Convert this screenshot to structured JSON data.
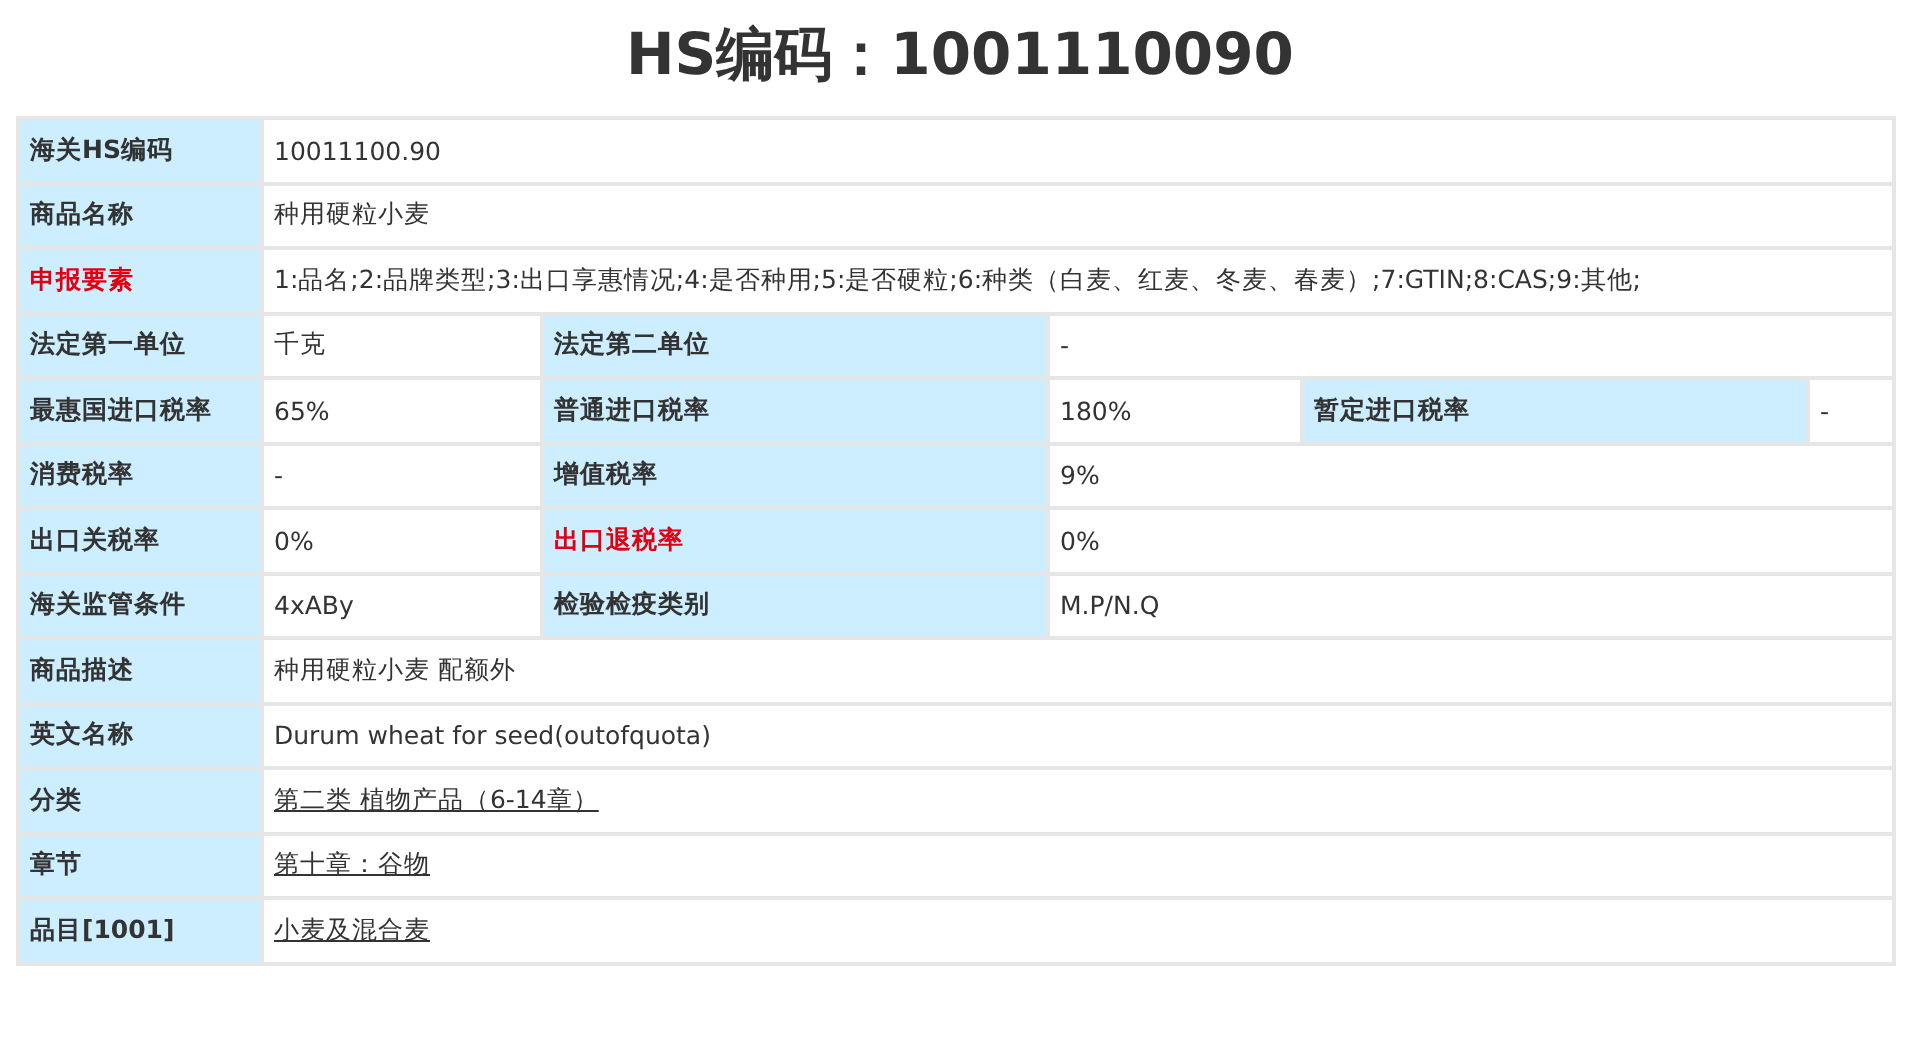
{
  "title": "HS编码：1001110090",
  "rows": [
    [
      {
        "kind": "label",
        "text": "海关HS编码"
      },
      {
        "kind": "value",
        "text": "10011100.90"
      }
    ],
    [
      {
        "kind": "label",
        "text": "商品名称"
      },
      {
        "kind": "value",
        "text": "种用硬粒小麦"
      }
    ],
    [
      {
        "kind": "alert_label",
        "text": "申报要素"
      },
      {
        "kind": "value",
        "text": "1:品名;2:品牌类型;3:出口享惠情况;4:是否种用;5:是否硬粒;6:种类（白麦、红麦、冬麦、春麦）;7:GTIN;8:CAS;9:其他;"
      }
    ],
    [
      {
        "kind": "label",
        "text": "法定第一单位"
      },
      {
        "kind": "value",
        "text": "千克"
      },
      {
        "kind": "label",
        "text": "法定第二单位"
      },
      {
        "kind": "value",
        "text": "-"
      }
    ],
    [
      {
        "kind": "label",
        "text": "最惠国进口税率"
      },
      {
        "kind": "value",
        "text": "65%"
      },
      {
        "kind": "label",
        "text": "普通进口税率"
      },
      {
        "kind": "value",
        "text": "180%"
      },
      {
        "kind": "label",
        "text": "暂定进口税率"
      },
      {
        "kind": "value",
        "text": "-"
      }
    ],
    [
      {
        "kind": "label",
        "text": "消费税率"
      },
      {
        "kind": "value",
        "text": "-"
      },
      {
        "kind": "label",
        "text": "增值税率"
      },
      {
        "kind": "value",
        "text": "9%"
      }
    ],
    [
      {
        "kind": "label",
        "text": "出口关税率"
      },
      {
        "kind": "value",
        "text": "0%"
      },
      {
        "kind": "alert_label",
        "text": "出口退税率"
      },
      {
        "kind": "value",
        "text": "0%"
      }
    ],
    [
      {
        "kind": "label",
        "text": "海关监管条件"
      },
      {
        "kind": "value",
        "text": "4xABy"
      },
      {
        "kind": "label",
        "text": "检验检疫类别"
      },
      {
        "kind": "value",
        "text": "M.P/N.Q"
      }
    ],
    [
      {
        "kind": "label",
        "text": "商品描述"
      },
      {
        "kind": "value",
        "text": "种用硬粒小麦 配额外"
      }
    ],
    [
      {
        "kind": "label",
        "text": "英文名称"
      },
      {
        "kind": "value",
        "text": "Durum wheat for seed(outofquota)"
      }
    ],
    [
      {
        "kind": "label",
        "text": "分类"
      },
      {
        "kind": "link",
        "text": "第二类 植物产品（6-14章）"
      }
    ],
    [
      {
        "kind": "label",
        "text": "章节"
      },
      {
        "kind": "link",
        "text": "第十章：谷物"
      }
    ],
    [
      {
        "kind": "label",
        "text": "品目[1001]"
      },
      {
        "kind": "link",
        "text": "小麦及混合麦"
      }
    ]
  ]
}
